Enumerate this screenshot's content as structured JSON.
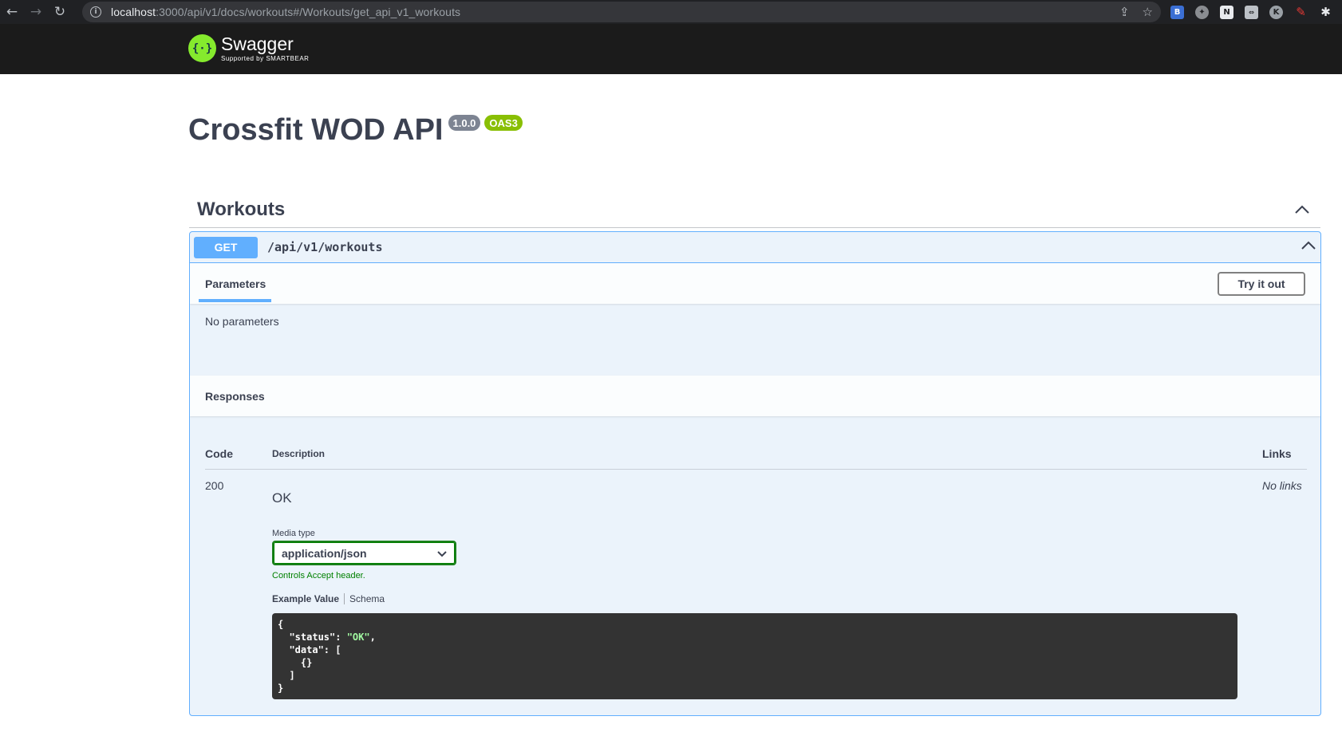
{
  "browser": {
    "url_host": "localhost",
    "url_rest": ":3000/api/v1/docs/workouts#/Workouts/get_api_v1_workouts"
  },
  "topbar": {
    "logo_word": "Swagger",
    "logo_sub": "Supported by SMARTBEAR"
  },
  "info": {
    "title": "Crossfit WOD API",
    "version": "1.0.0",
    "spec": "OAS3"
  },
  "tag": {
    "name": "Workouts"
  },
  "operation": {
    "method": "GET",
    "path": "/api/v1/workouts",
    "parameters_tab": "Parameters",
    "try_button": "Try it out",
    "no_params": "No parameters",
    "responses_title": "Responses",
    "columns": {
      "code": "Code",
      "description": "Description",
      "links": "Links"
    },
    "response": {
      "code": "200",
      "description": "OK",
      "links": "No links",
      "media_type_label": "Media type",
      "media_type": "application/json",
      "controls_note": "Controls Accept header.",
      "example_tab": "Example Value",
      "schema_tab": "Schema",
      "example": {
        "line1": "{",
        "status_key": "  \"status\": ",
        "status_val": "\"OK\"",
        "status_comma": ",",
        "line3": "  \"data\": [",
        "line4": "    {}",
        "line5": "  ]",
        "line6": "}"
      }
    }
  },
  "colors": {
    "get": "#61affe",
    "topbar": "#1b1b1b",
    "version_badge": "#7d8492",
    "oas_badge": "#89bf04"
  }
}
